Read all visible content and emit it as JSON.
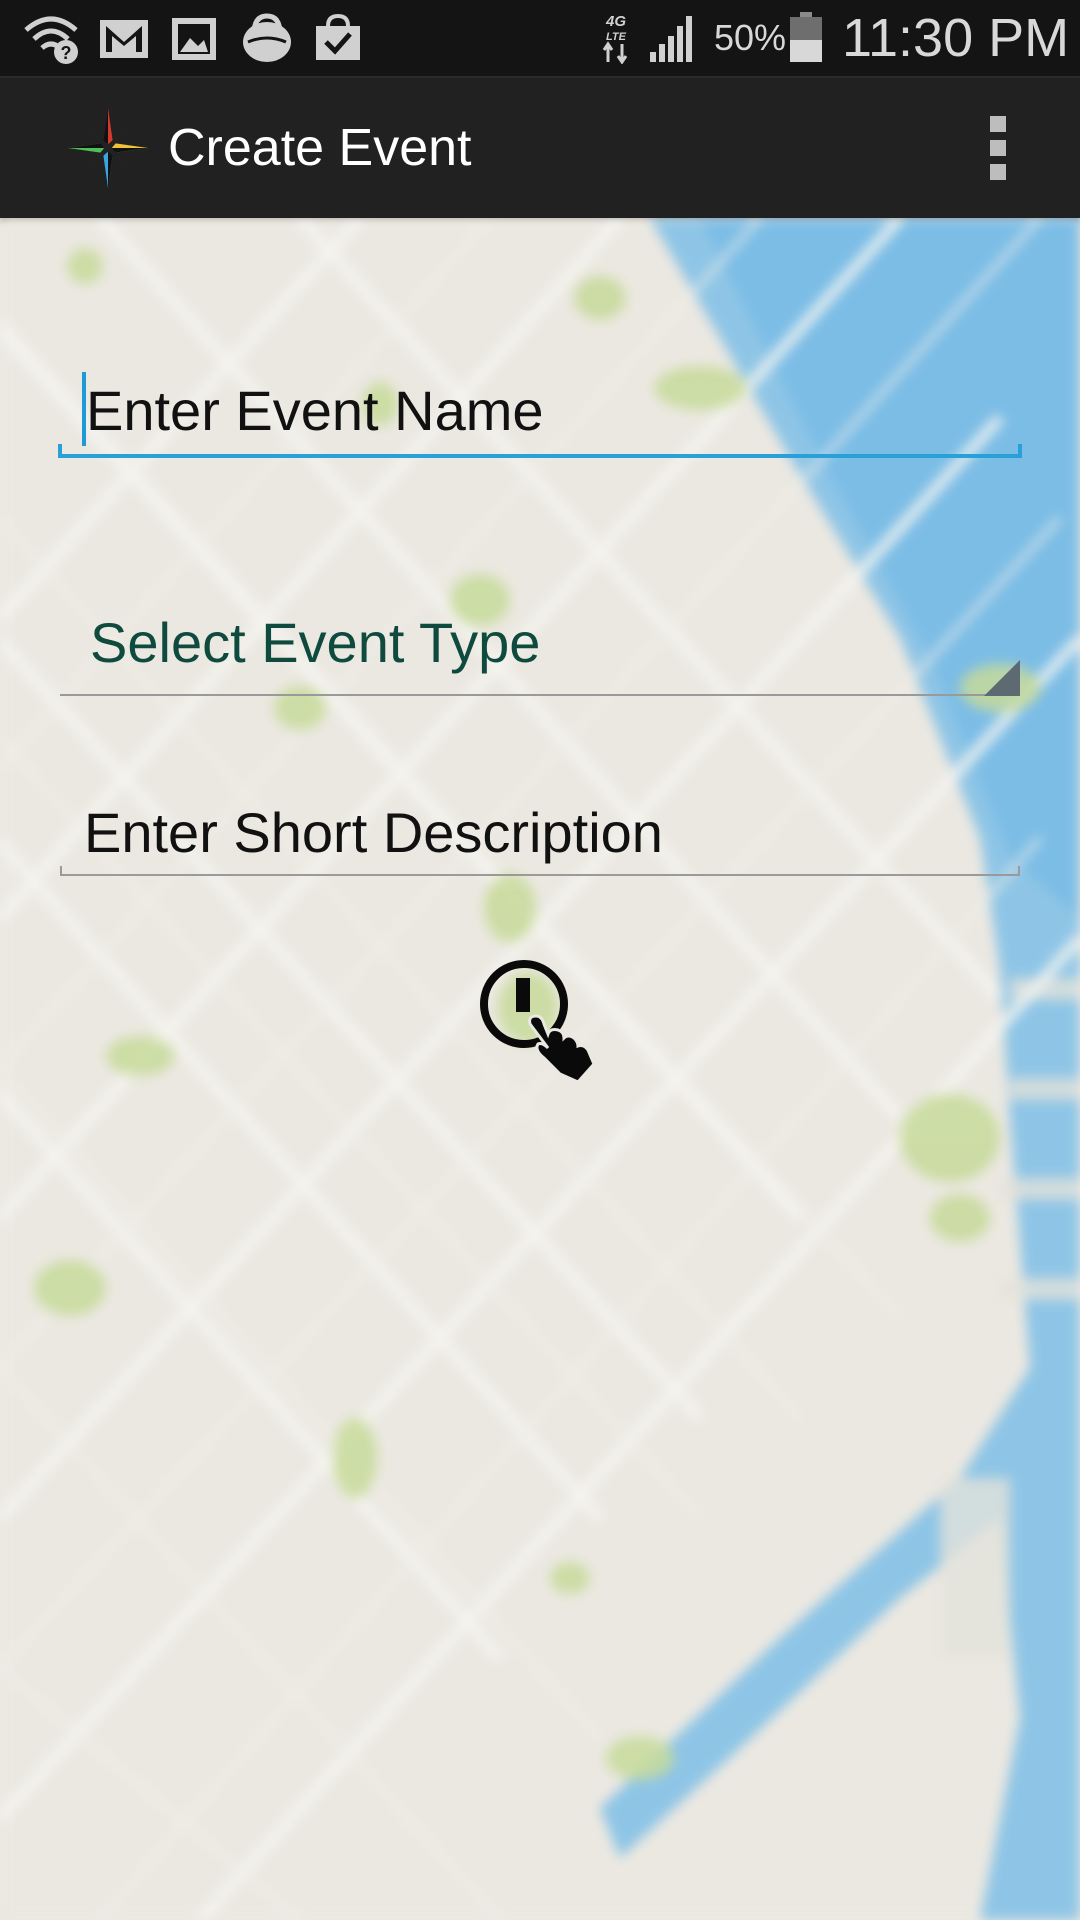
{
  "status_bar": {
    "battery_percent": "50%",
    "time": "11:30 PM",
    "network": "4G LTE",
    "icons": [
      "wifi-icon",
      "gmail-icon",
      "gallery-icon",
      "shopping-bag-icon",
      "task-check-icon",
      "network-4g-lte-icon",
      "signal-icon",
      "battery-icon"
    ]
  },
  "action_bar": {
    "title": "Create Event",
    "logo_icon": "compass-star-icon",
    "menu_icon": "overflow-menu-icon"
  },
  "form": {
    "event_name_placeholder": "Enter Event Name",
    "event_type_label": "Select Event Type",
    "description_placeholder": "Enter Short Description",
    "submit_icon": "power-touch-icon"
  },
  "colors": {
    "accent_underline": "#2aa0d8",
    "select_text": "#0f4a3e",
    "action_bar_bg": "#212121"
  }
}
